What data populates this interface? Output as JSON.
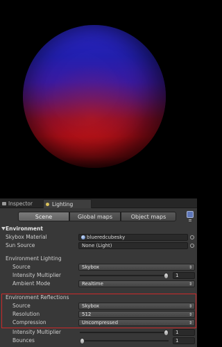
{
  "tabs": {
    "inspector": "Inspector",
    "lighting": "Lighting"
  },
  "toolbar": {
    "scene": "Scene",
    "global_maps": "Global maps",
    "object_maps": "Object maps"
  },
  "environment": {
    "header": "Environment",
    "skybox_material": {
      "label": "Skybox Material",
      "value": "blueredcubesky"
    },
    "sun_source": {
      "label": "Sun Source",
      "value": "None (Light)"
    }
  },
  "lighting": {
    "header": "Environment Lighting",
    "source": {
      "label": "Source",
      "value": "Skybox"
    },
    "intensity": {
      "label": "Intensity Multiplier",
      "value": "1",
      "fraction": 1.0
    },
    "ambient_mode": {
      "label": "Ambient Mode",
      "value": "Realtime"
    }
  },
  "reflections": {
    "header": "Environment Reflections",
    "source": {
      "label": "Source",
      "value": "Skybox"
    },
    "resolution": {
      "label": "Resolution",
      "value": "512"
    },
    "compression": {
      "label": "Compression",
      "value": "Uncompressed"
    },
    "intensity": {
      "label": "Intensity Multiplier",
      "value": "1",
      "fraction": 1.0
    },
    "bounces": {
      "label": "Bounces",
      "value": "1",
      "fraction": 0.0
    }
  },
  "colors": {
    "highlight": "#cc2a2a",
    "sky_top": "#2a26c4",
    "sky_bottom": "#a40d18"
  },
  "icons": [
    "inspector-icon",
    "lighting-icon",
    "auto-generate-icon",
    "object-picker-icon",
    "dropdown-arrow-icon"
  ]
}
